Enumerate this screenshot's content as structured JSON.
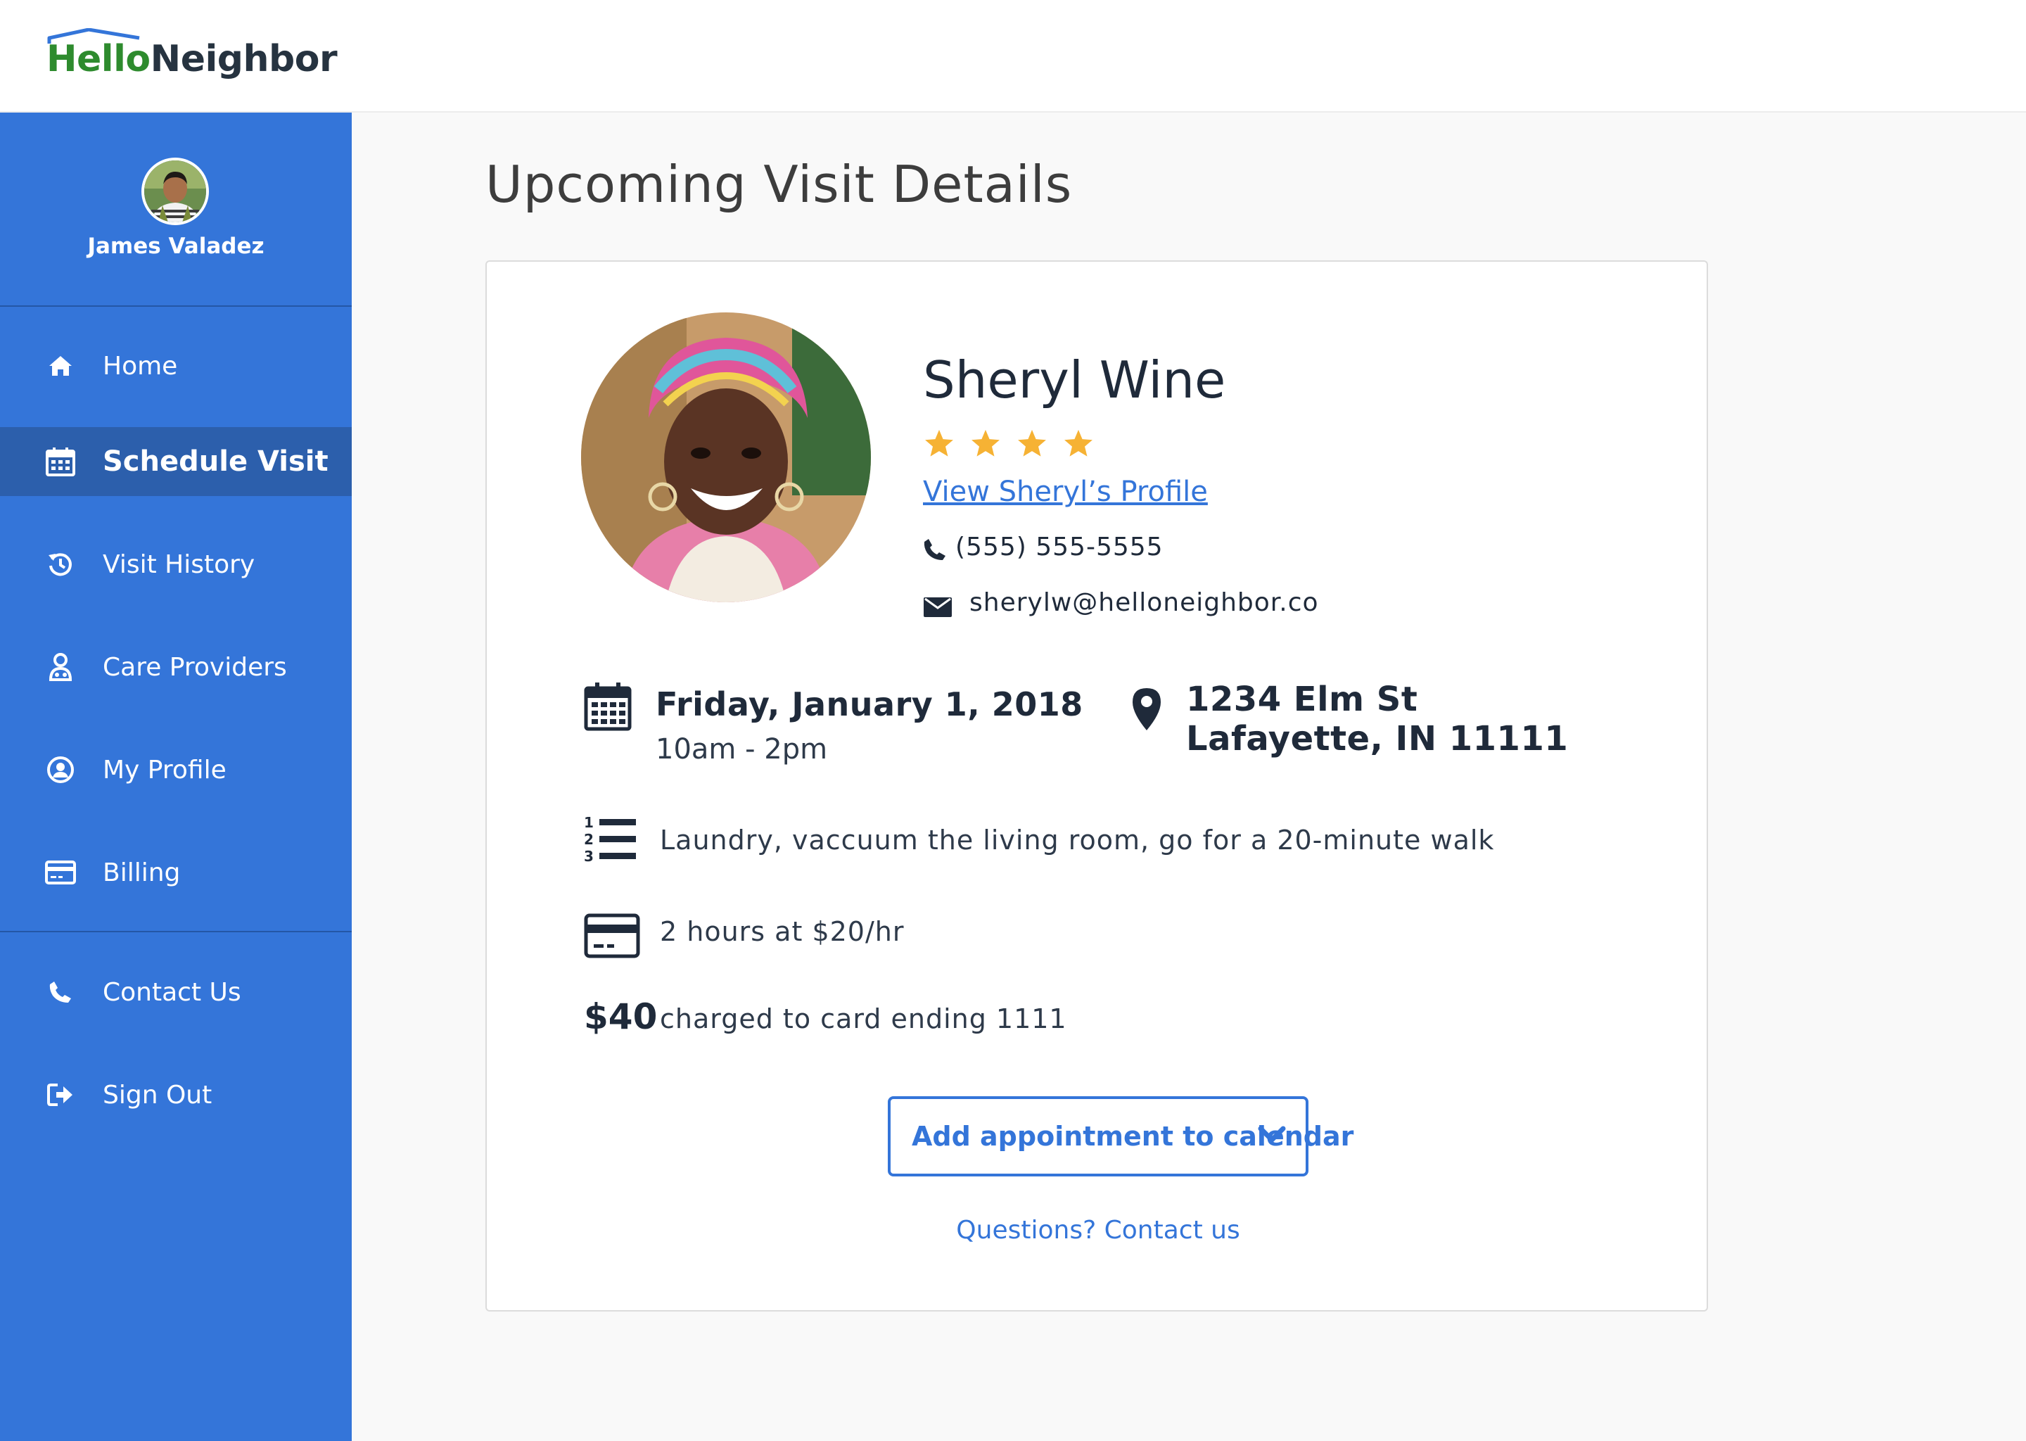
{
  "app": {
    "logo_hello": "Hello",
    "logo_neighbor": "Neighbor"
  },
  "colors": {
    "brand_blue": "#3475d9",
    "sidebar_active": "#2c5fac",
    "logo_green": "#2e8b2e",
    "star": "#f6b234",
    "text_dark": "#1f2a3a"
  },
  "user": {
    "name": "James Valadez",
    "avatar_icon": "user-avatar-photo"
  },
  "sidebar": {
    "items": [
      {
        "label": "Home",
        "icon": "home-icon",
        "active": false
      },
      {
        "label": "Schedule Visit",
        "icon": "calendar-icon",
        "active": true
      },
      {
        "label": "Visit History",
        "icon": "history-icon",
        "active": false
      },
      {
        "label": "Care Providers",
        "icon": "care-provider-icon",
        "active": false
      },
      {
        "label": "My Profile",
        "icon": "user-circle-icon",
        "active": false
      },
      {
        "label": "Billing",
        "icon": "credit-card-icon",
        "active": false
      },
      {
        "label": "Contact Us",
        "icon": "phone-icon",
        "active": false
      },
      {
        "label": "Sign Out",
        "icon": "sign-out-icon",
        "active": false
      }
    ]
  },
  "main": {
    "title": "Upcoming Visit Details",
    "provider": {
      "name": "Sheryl Wine",
      "rating": 4,
      "rating_max": 4,
      "profile_link": "View Sheryl’s Profile",
      "phone": "(555) 555-5555",
      "email": "sherylw@helloneighbor.co"
    },
    "visit": {
      "date": "Friday, January 1, 2018",
      "time": "10am - 2pm",
      "address_line1": "1234 Elm St",
      "address_line2": "Lafayette, IN 11111",
      "tasks": "Laundry, vaccuum the living room, go for a 20-minute walk",
      "rate": "2 hours at $20/hr",
      "amount": "$40",
      "charge_note": "charged to card ending 1111"
    },
    "calendar_button": "Add appointment to calendar",
    "questions_link": "Questions? Contact us"
  }
}
